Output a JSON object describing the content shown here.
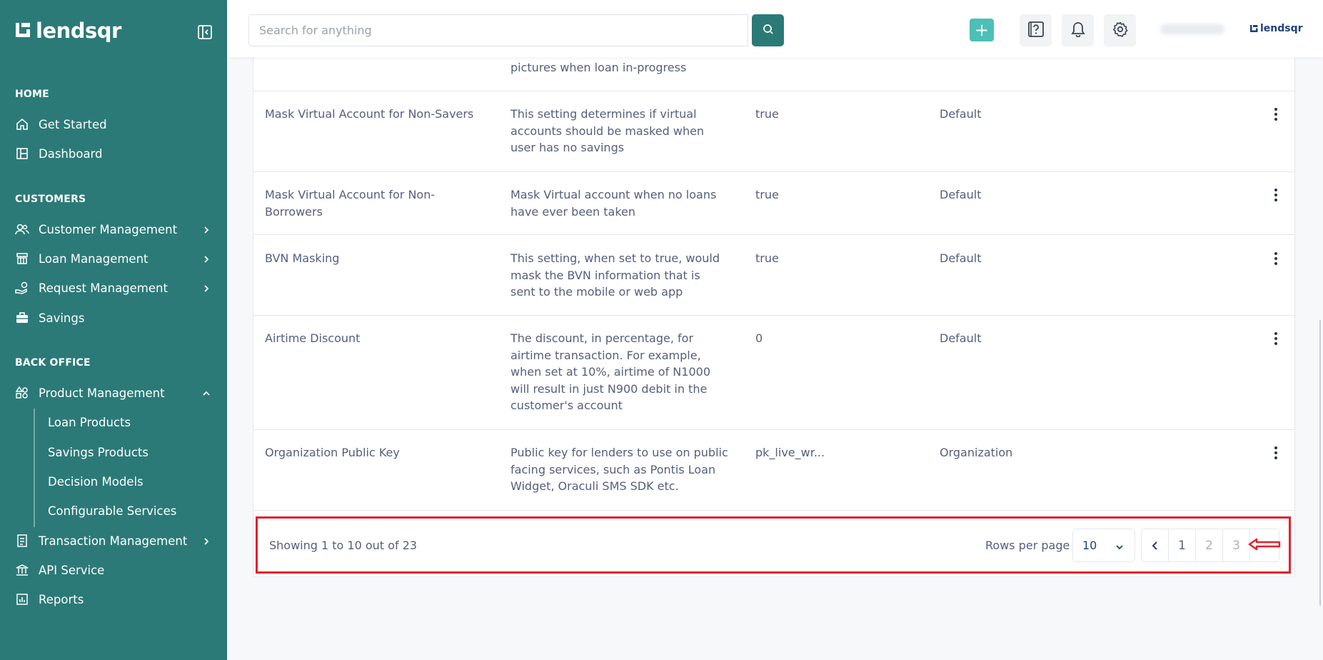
{
  "brand": {
    "name": "lendsqr",
    "small_name": "lendsqr"
  },
  "search": {
    "placeholder": "Search for anything"
  },
  "sidebar": {
    "sections": {
      "home": "HOME",
      "customers": "CUSTOMERS",
      "back_office": "BACK OFFICE"
    },
    "items": {
      "get_started": "Get Started",
      "dashboard": "Dashboard",
      "customer_management": "Customer Management",
      "loan_management": "Loan Management",
      "request_management": "Request Management",
      "savings": "Savings",
      "product_management": "Product Management",
      "loan_products": "Loan Products",
      "savings_products": "Savings Products",
      "decision_models": "Decision Models",
      "configurable_services": "Configurable Services",
      "transaction_management": "Transaction Management",
      "api_service": "API Service",
      "reports": "Reports"
    }
  },
  "table": {
    "partial_row": {
      "description_line": "pictures when loan in-progress"
    },
    "rows": [
      {
        "name": "Mask Virtual Account for Non-Savers",
        "description": "This setting determines if virtual accounts should be masked when user has no savings",
        "value": "true",
        "type": "Default"
      },
      {
        "name": "Mask Virtual Account for Non-Borrowers",
        "description": "Mask Virtual account when no loans have ever been taken",
        "value": "true",
        "type": "Default"
      },
      {
        "name": "BVN Masking",
        "description": "This setting, when set to true, would mask the BVN information that is sent to the mobile or web app",
        "value": "true",
        "type": "Default"
      },
      {
        "name": "Airtime Discount",
        "description": "The discount, in percentage, for airtime transaction. For example, when set at 10%, airtime of N1000 will result in just N900 debit in the customer's account",
        "value": "0",
        "type": "Default"
      },
      {
        "name": "Organization Public Key",
        "description": "Public key for lenders to use on public facing services, such as Pontis Loan Widget, Oraculi SMS SDK etc.",
        "value": "pk_live_wr...",
        "type": "Organization"
      }
    ]
  },
  "pagination": {
    "showing": "Showing 1 to 10 out of 23",
    "rows_per_page_label": "Rows per page",
    "rows_per_page_value": "10",
    "pages": [
      "1",
      "2",
      "3"
    ]
  },
  "colors": {
    "sidebar": "#2b7a78",
    "accent": "#4cc0b8",
    "highlight": "#e0212c"
  }
}
